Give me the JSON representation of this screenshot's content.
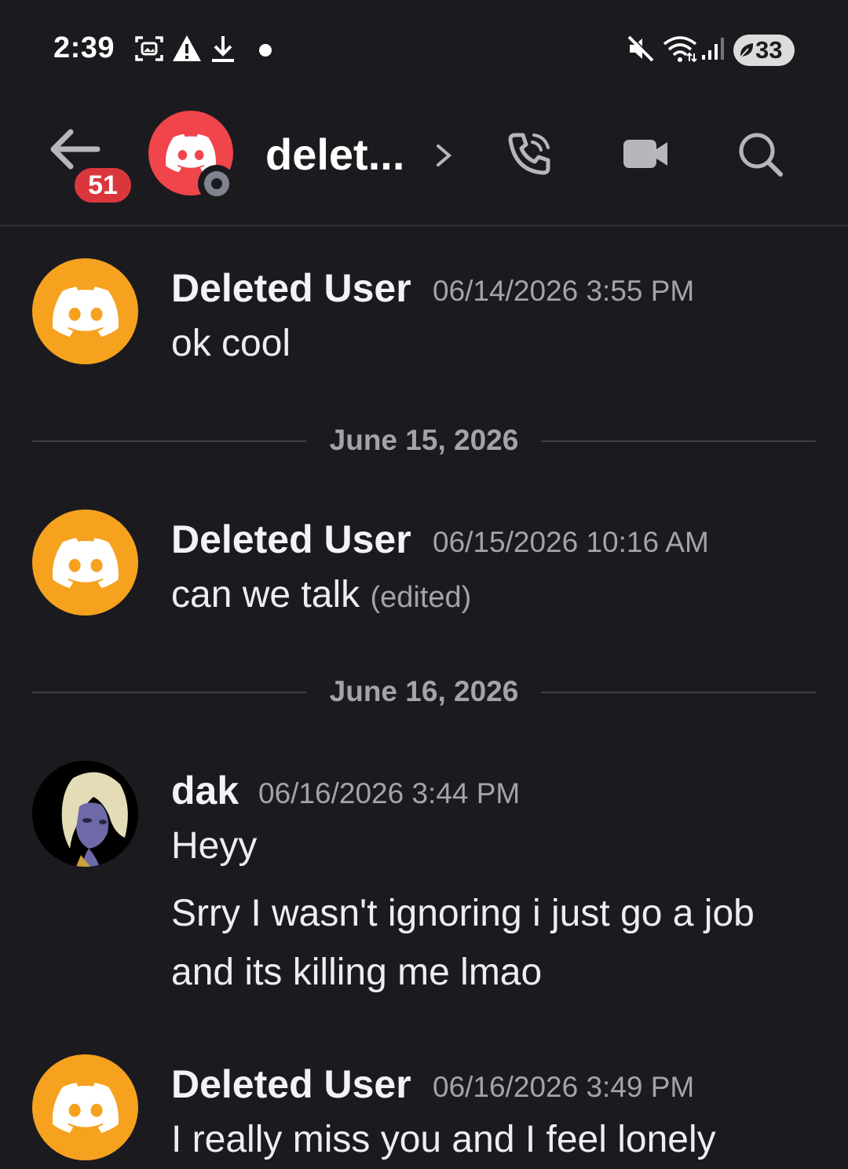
{
  "status_bar": {
    "time": "2:39",
    "icons": [
      "screenshot-icon",
      "alert-icon",
      "download-icon",
      "dot-icon",
      "mute-icon",
      "wifi-icon",
      "signal-icon"
    ],
    "battery": "33"
  },
  "header": {
    "unread_count": "51",
    "channel_name": "delet...",
    "icons": [
      "back-arrow-icon",
      "chevron-right-icon",
      "voice-call-icon",
      "video-call-icon",
      "search-icon"
    ]
  },
  "colors": {
    "background": "#1b1b1f",
    "badge_red": "#da373c",
    "discord_red_avatar": "#f0454a",
    "discord_orange_avatar": "#f6a21f",
    "muted_text": "#a2a4ab"
  },
  "messages": [
    {
      "username": "Deleted User",
      "timestamp": "06/14/2026 3:55 PM",
      "lines": [
        "ok cool"
      ]
    },
    {
      "date_separator": "June 15, 2026"
    },
    {
      "username": "Deleted User",
      "timestamp": "06/15/2026 10:16 AM",
      "lines": [
        "can we talk"
      ],
      "edited": "(edited)"
    },
    {
      "date_separator": "June 16, 2026"
    },
    {
      "username": "dak",
      "timestamp": "06/16/2026 3:44 PM",
      "lines": [
        "Heyy",
        "Srry I wasn't ignoring i just go a job",
        "and its killing me lmao"
      ]
    },
    {
      "username": "Deleted User",
      "timestamp": "06/16/2026 3:49 PM",
      "lines": [
        "I really miss you and I feel lonely"
      ]
    }
  ]
}
